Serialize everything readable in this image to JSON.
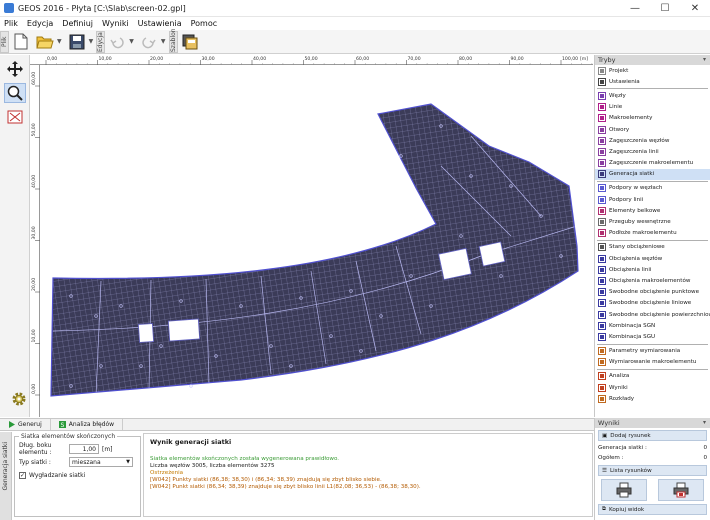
{
  "window": {
    "title": "GEOS 2016 - Płyta [C:\\Slab\\screen-02.gpl]",
    "minimize": "—",
    "maximize": "☐",
    "close": "✕"
  },
  "menu": [
    "Plik",
    "Edycja",
    "Definiuj",
    "Wyniki",
    "Ustawienia",
    "Pomoc"
  ],
  "toolbar": {
    "vtab_plik": "Plik",
    "vtab_edycja": "Edycja",
    "vtab_szablon": "Szablon"
  },
  "ruler": {
    "x_ticks": [
      "0,00",
      "10,00",
      "20,00",
      "30,00",
      "40,00",
      "50,00",
      "60,00",
      "70,00",
      "80,00",
      "90,00",
      "100,00"
    ],
    "x_unit": "[m]",
    "y_ticks": [
      "0,00",
      "10,00",
      "20,00",
      "30,00",
      "40,00",
      "50,00",
      "60,00"
    ]
  },
  "modes": {
    "header": "Tryby",
    "items": [
      {
        "label": "Projekt",
        "color": "#888888"
      },
      {
        "label": "Ustawienia",
        "color": "#444444"
      },
      {
        "label": "Węzły",
        "color": "#7a3fb0"
      },
      {
        "label": "Linie",
        "color": "#b01f8a"
      },
      {
        "label": "Makroelementy",
        "color": "#b01f8a"
      },
      {
        "label": "Otwory",
        "color": "#8a3fa0"
      },
      {
        "label": "Zagęszczenia węzłów",
        "color": "#8a3fa0"
      },
      {
        "label": "Zagęszczenia linii",
        "color": "#8a3fa0"
      },
      {
        "label": "Zagęszczenie makroelementu",
        "color": "#8a3fa0"
      },
      {
        "label": "Generacja siatki",
        "color": "#3a3a7a",
        "active": true
      },
      {
        "label": "Podpory w węzłach",
        "color": "#5a5ad0"
      },
      {
        "label": "Podpory linii",
        "color": "#5a5ad0"
      },
      {
        "label": "Elementy belkowe",
        "color": "#b03070"
      },
      {
        "label": "Przeguby wewnętrzne",
        "color": "#6a6a6a"
      },
      {
        "label": "Podłoże makroelementu",
        "color": "#b03070"
      },
      {
        "label": "Stany obciążeniowe",
        "color": "#555555"
      },
      {
        "label": "Obciążenia węzłów",
        "color": "#3a3aa0"
      },
      {
        "label": "Obciążenia linii",
        "color": "#3a3aa0"
      },
      {
        "label": "Obciążenia makroelementów",
        "color": "#3a3aa0"
      },
      {
        "label": "Swobodne obciążenie punktowe",
        "color": "#3a3aa0"
      },
      {
        "label": "Swobodne obciążenie liniowe",
        "color": "#3a3aa0"
      },
      {
        "label": "Swobodne obciążenie powierzchniowe",
        "color": "#3a3aa0"
      },
      {
        "label": "Kombinacja SGN",
        "color": "#3a3aa0"
      },
      {
        "label": "Kombinacja SGU",
        "color": "#3a3aa0"
      },
      {
        "label": "Parametry wymiarowania",
        "color": "#c06a20"
      },
      {
        "label": "Wymiarowanie makroelementu",
        "color": "#c06a20"
      },
      {
        "label": "Analiza",
        "color": "#c04020"
      },
      {
        "label": "Wyniki",
        "color": "#c04020"
      },
      {
        "label": "Rozkłady",
        "color": "#c06a20"
      }
    ],
    "separators_after": [
      1,
      9,
      14,
      23,
      25
    ]
  },
  "bottom_tabs": [
    "Generuj",
    "Analiza błędów"
  ],
  "side_tab": "Generacja siatki",
  "mesh_settings": {
    "legend": "Siatka elementów skończonych",
    "edge_length_label": "Dług. boku elementu :",
    "edge_length_value": "1,00",
    "edge_length_unit": "[m]",
    "type_label": "Typ siatki :",
    "type_value": "mieszana",
    "smoothing_label": "Wygładzanie siatki",
    "smoothing_checked": true
  },
  "result": {
    "heading": "Wynik generacji siatki",
    "ok": "Siatka elementów skończonych została wygenerowana prawidłowo.",
    "counts": "Liczba węzłów 3005, liczba elementów 3275",
    "warn_heading": "Ostrzeżenia",
    "warnings": [
      "[W042]    Punkty siatki (86,38; 38,30) i (86,34; 38,39) znajdują się zbyt blisko siebie.",
      "[W042]    Punkt siatki (86,34; 38,39) znajduje się zbyt blisko linii L1(82,08; 36,53) - (86,38; 38,30)."
    ]
  },
  "outputs": {
    "header": "Wyniki",
    "add_figure": "Dodaj rysunek",
    "rows": [
      {
        "label": "Generacja siatki :",
        "value": "0"
      },
      {
        "label": "Ogółem :",
        "value": "0"
      }
    ],
    "figure_list": "Lista rysunków",
    "copy_view": "Kopiuj widok"
  },
  "accent": "#3a3ab0"
}
